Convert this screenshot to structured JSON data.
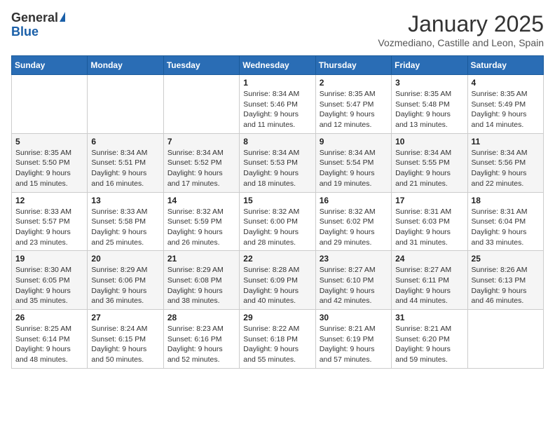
{
  "logo": {
    "general": "General",
    "blue": "Blue"
  },
  "header": {
    "month": "January 2025",
    "location": "Vozmediano, Castille and Leon, Spain"
  },
  "weekdays": [
    "Sunday",
    "Monday",
    "Tuesday",
    "Wednesday",
    "Thursday",
    "Friday",
    "Saturday"
  ],
  "weeks": [
    [
      {
        "day": "",
        "sunrise": "",
        "sunset": "",
        "daylight": ""
      },
      {
        "day": "",
        "sunrise": "",
        "sunset": "",
        "daylight": ""
      },
      {
        "day": "",
        "sunrise": "",
        "sunset": "",
        "daylight": ""
      },
      {
        "day": "1",
        "sunrise": "Sunrise: 8:34 AM",
        "sunset": "Sunset: 5:46 PM",
        "daylight": "Daylight: 9 hours and 11 minutes."
      },
      {
        "day": "2",
        "sunrise": "Sunrise: 8:35 AM",
        "sunset": "Sunset: 5:47 PM",
        "daylight": "Daylight: 9 hours and 12 minutes."
      },
      {
        "day": "3",
        "sunrise": "Sunrise: 8:35 AM",
        "sunset": "Sunset: 5:48 PM",
        "daylight": "Daylight: 9 hours and 13 minutes."
      },
      {
        "day": "4",
        "sunrise": "Sunrise: 8:35 AM",
        "sunset": "Sunset: 5:49 PM",
        "daylight": "Daylight: 9 hours and 14 minutes."
      }
    ],
    [
      {
        "day": "5",
        "sunrise": "Sunrise: 8:35 AM",
        "sunset": "Sunset: 5:50 PM",
        "daylight": "Daylight: 9 hours and 15 minutes."
      },
      {
        "day": "6",
        "sunrise": "Sunrise: 8:34 AM",
        "sunset": "Sunset: 5:51 PM",
        "daylight": "Daylight: 9 hours and 16 minutes."
      },
      {
        "day": "7",
        "sunrise": "Sunrise: 8:34 AM",
        "sunset": "Sunset: 5:52 PM",
        "daylight": "Daylight: 9 hours and 17 minutes."
      },
      {
        "day": "8",
        "sunrise": "Sunrise: 8:34 AM",
        "sunset": "Sunset: 5:53 PM",
        "daylight": "Daylight: 9 hours and 18 minutes."
      },
      {
        "day": "9",
        "sunrise": "Sunrise: 8:34 AM",
        "sunset": "Sunset: 5:54 PM",
        "daylight": "Daylight: 9 hours and 19 minutes."
      },
      {
        "day": "10",
        "sunrise": "Sunrise: 8:34 AM",
        "sunset": "Sunset: 5:55 PM",
        "daylight": "Daylight: 9 hours and 21 minutes."
      },
      {
        "day": "11",
        "sunrise": "Sunrise: 8:34 AM",
        "sunset": "Sunset: 5:56 PM",
        "daylight": "Daylight: 9 hours and 22 minutes."
      }
    ],
    [
      {
        "day": "12",
        "sunrise": "Sunrise: 8:33 AM",
        "sunset": "Sunset: 5:57 PM",
        "daylight": "Daylight: 9 hours and 23 minutes."
      },
      {
        "day": "13",
        "sunrise": "Sunrise: 8:33 AM",
        "sunset": "Sunset: 5:58 PM",
        "daylight": "Daylight: 9 hours and 25 minutes."
      },
      {
        "day": "14",
        "sunrise": "Sunrise: 8:32 AM",
        "sunset": "Sunset: 5:59 PM",
        "daylight": "Daylight: 9 hours and 26 minutes."
      },
      {
        "day": "15",
        "sunrise": "Sunrise: 8:32 AM",
        "sunset": "Sunset: 6:00 PM",
        "daylight": "Daylight: 9 hours and 28 minutes."
      },
      {
        "day": "16",
        "sunrise": "Sunrise: 8:32 AM",
        "sunset": "Sunset: 6:02 PM",
        "daylight": "Daylight: 9 hours and 29 minutes."
      },
      {
        "day": "17",
        "sunrise": "Sunrise: 8:31 AM",
        "sunset": "Sunset: 6:03 PM",
        "daylight": "Daylight: 9 hours and 31 minutes."
      },
      {
        "day": "18",
        "sunrise": "Sunrise: 8:31 AM",
        "sunset": "Sunset: 6:04 PM",
        "daylight": "Daylight: 9 hours and 33 minutes."
      }
    ],
    [
      {
        "day": "19",
        "sunrise": "Sunrise: 8:30 AM",
        "sunset": "Sunset: 6:05 PM",
        "daylight": "Daylight: 9 hours and 35 minutes."
      },
      {
        "day": "20",
        "sunrise": "Sunrise: 8:29 AM",
        "sunset": "Sunset: 6:06 PM",
        "daylight": "Daylight: 9 hours and 36 minutes."
      },
      {
        "day": "21",
        "sunrise": "Sunrise: 8:29 AM",
        "sunset": "Sunset: 6:08 PM",
        "daylight": "Daylight: 9 hours and 38 minutes."
      },
      {
        "day": "22",
        "sunrise": "Sunrise: 8:28 AM",
        "sunset": "Sunset: 6:09 PM",
        "daylight": "Daylight: 9 hours and 40 minutes."
      },
      {
        "day": "23",
        "sunrise": "Sunrise: 8:27 AM",
        "sunset": "Sunset: 6:10 PM",
        "daylight": "Daylight: 9 hours and 42 minutes."
      },
      {
        "day": "24",
        "sunrise": "Sunrise: 8:27 AM",
        "sunset": "Sunset: 6:11 PM",
        "daylight": "Daylight: 9 hours and 44 minutes."
      },
      {
        "day": "25",
        "sunrise": "Sunrise: 8:26 AM",
        "sunset": "Sunset: 6:13 PM",
        "daylight": "Daylight: 9 hours and 46 minutes."
      }
    ],
    [
      {
        "day": "26",
        "sunrise": "Sunrise: 8:25 AM",
        "sunset": "Sunset: 6:14 PM",
        "daylight": "Daylight: 9 hours and 48 minutes."
      },
      {
        "day": "27",
        "sunrise": "Sunrise: 8:24 AM",
        "sunset": "Sunset: 6:15 PM",
        "daylight": "Daylight: 9 hours and 50 minutes."
      },
      {
        "day": "28",
        "sunrise": "Sunrise: 8:23 AM",
        "sunset": "Sunset: 6:16 PM",
        "daylight": "Daylight: 9 hours and 52 minutes."
      },
      {
        "day": "29",
        "sunrise": "Sunrise: 8:22 AM",
        "sunset": "Sunset: 6:18 PM",
        "daylight": "Daylight: 9 hours and 55 minutes."
      },
      {
        "day": "30",
        "sunrise": "Sunrise: 8:21 AM",
        "sunset": "Sunset: 6:19 PM",
        "daylight": "Daylight: 9 hours and 57 minutes."
      },
      {
        "day": "31",
        "sunrise": "Sunrise: 8:21 AM",
        "sunset": "Sunset: 6:20 PM",
        "daylight": "Daylight: 9 hours and 59 minutes."
      },
      {
        "day": "",
        "sunrise": "",
        "sunset": "",
        "daylight": ""
      }
    ]
  ]
}
